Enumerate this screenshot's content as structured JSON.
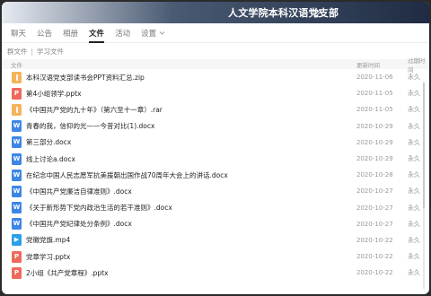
{
  "window": {
    "title": "人文学院本科汉语党支部"
  },
  "tabs": [
    {
      "label": "聊天",
      "active": false
    },
    {
      "label": "公告",
      "active": false
    },
    {
      "label": "相册",
      "active": false
    },
    {
      "label": "文件",
      "active": true
    },
    {
      "label": "活动",
      "active": false
    },
    {
      "label": "设置",
      "active": false,
      "dropdown": true
    }
  ],
  "breadcrumb": [
    "群文件",
    "学习文件"
  ],
  "table": {
    "headers": {
      "name": "文件",
      "date": "更新时间",
      "expiry": "过期时间"
    },
    "rows": [
      {
        "icon": "zip",
        "name": "本科汉语党支部读书会PPT资料汇总.zip",
        "date": "2020-11-06",
        "expiry": "永久"
      },
      {
        "icon": "ppt",
        "name": "第4小组领学.pptx",
        "date": "2020-11-05",
        "expiry": "永久"
      },
      {
        "icon": "zip",
        "name": "《中国共产党的九十年》（第六至十一章）.rar",
        "date": "2020-11-05",
        "expiry": "永久"
      },
      {
        "icon": "doc",
        "name": "青春的我，信仰的光——今昔对比(1).docx",
        "date": "2020-10-29",
        "expiry": "永久"
      },
      {
        "icon": "doc",
        "name": "第三部分.docx",
        "date": "2020-10-29",
        "expiry": "永久"
      },
      {
        "icon": "doc",
        "name": "线上讨论a.docx",
        "date": "2020-10-29",
        "expiry": "永久"
      },
      {
        "icon": "doc",
        "name": "在纪念中国人民志愿军抗美援朝出国作战70周年大会上的讲话.docx",
        "date": "2020-10-28",
        "expiry": "永久"
      },
      {
        "icon": "doc",
        "name": "《中国共产党廉洁自律准则》.docx",
        "date": "2020-10-27",
        "expiry": "永久"
      },
      {
        "icon": "doc",
        "name": "《关于新形势下党内政治生活的若干准则》.docx",
        "date": "2020-10-27",
        "expiry": "永久"
      },
      {
        "icon": "doc",
        "name": "《中国共产党纪律处分条例》.docx",
        "date": "2020-10-27",
        "expiry": "永久"
      },
      {
        "icon": "mp4",
        "name": "党徽党旗.mp4",
        "date": "2020-10-22",
        "expiry": "永久"
      },
      {
        "icon": "ppt",
        "name": "党章学习.pptx",
        "date": "2020-10-22",
        "expiry": "永久"
      },
      {
        "icon": "ppt",
        "name": "2小组《共产党章程》.pptx",
        "date": "2020-10-22",
        "expiry": "永久"
      }
    ]
  },
  "colors": {
    "zip": "#f4b45b",
    "ppt": "#ef6a5c",
    "doc": "#3d86e6",
    "mp4": "#2aa0e8"
  }
}
